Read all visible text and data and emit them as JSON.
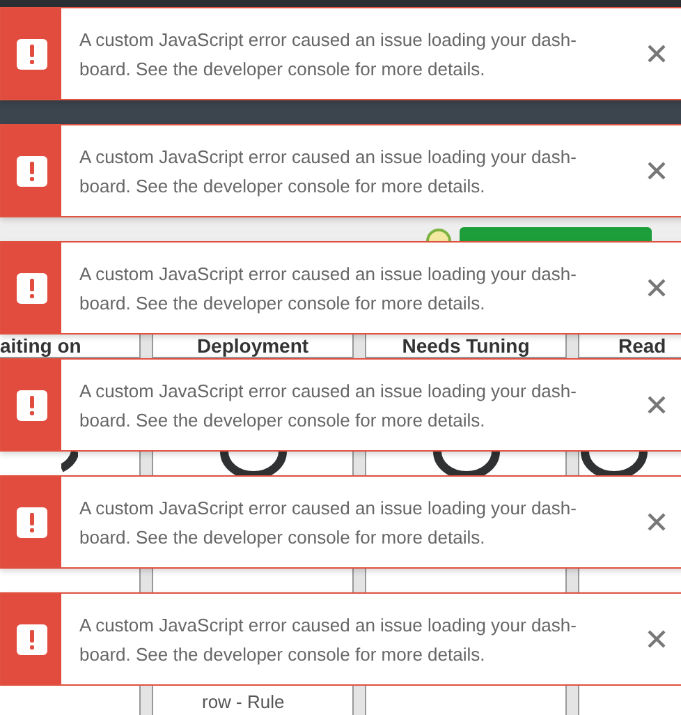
{
  "columns": [
    {
      "heading": "aiting on"
    },
    {
      "heading": "Deployment"
    },
    {
      "heading": "Needs Tuning"
    },
    {
      "heading": "Read"
    }
  ],
  "rule_row": {
    "text": "row - Rule"
  },
  "toasts": [
    {
      "kind": "error",
      "message": "A custom JavaScript error caused an issue loading your dash-board. See the developer console for more details."
    },
    {
      "kind": "error",
      "message": "A custom JavaScript error caused an issue loading your dash-board. See the developer console for more details."
    },
    {
      "kind": "error",
      "message": "A custom JavaScript error caused an issue loading your dash-board. See the developer console for more details."
    },
    {
      "kind": "error",
      "message": "A custom JavaScript error caused an issue loading your dash-board. See the developer console for more details."
    },
    {
      "kind": "error",
      "message": "A custom JavaScript error caused an issue loading your dash-board. See the developer console for more details."
    },
    {
      "kind": "error",
      "message": "A custom JavaScript error caused an issue loading your dash-board. See the developer console for more details."
    }
  ]
}
